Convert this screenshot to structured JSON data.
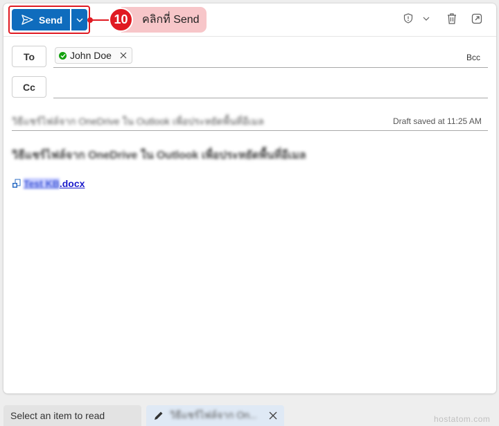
{
  "toolbar": {
    "send_label": "Send",
    "callout_number": "10",
    "callout_text": "คลิกที่ Send"
  },
  "recipients": {
    "to_label": "To",
    "cc_label": "Cc",
    "bcc_label": "Bcc",
    "to_chips": [
      {
        "name": "John Doe",
        "status": "verified"
      }
    ]
  },
  "subject": {
    "value": "วิธีแชร์ไฟล์จาก OneDrive ใน Outlook เพื่อประหยัดพื้นที่อีเมล",
    "draft_status": "Draft saved at 11:25 AM"
  },
  "body": {
    "text": "วิธีแชร์ไฟล์จาก OneDrive ใน Outlook เพื่อประหยัดพื้นที่อีเมล",
    "attachment_blurred": "Test KB",
    "attachment_ext": ".docx"
  },
  "bottom_bar": {
    "reading_pane_label": "Select an item to read",
    "draft_tab_label": "วิธีแชร์ไฟล์จาก On..."
  },
  "watermark": "hostatom.com",
  "colors": {
    "primary": "#0f6cbd",
    "highlight": "#e01a22",
    "callout_bg": "#f7c6c9",
    "ok": "#13a10e"
  }
}
